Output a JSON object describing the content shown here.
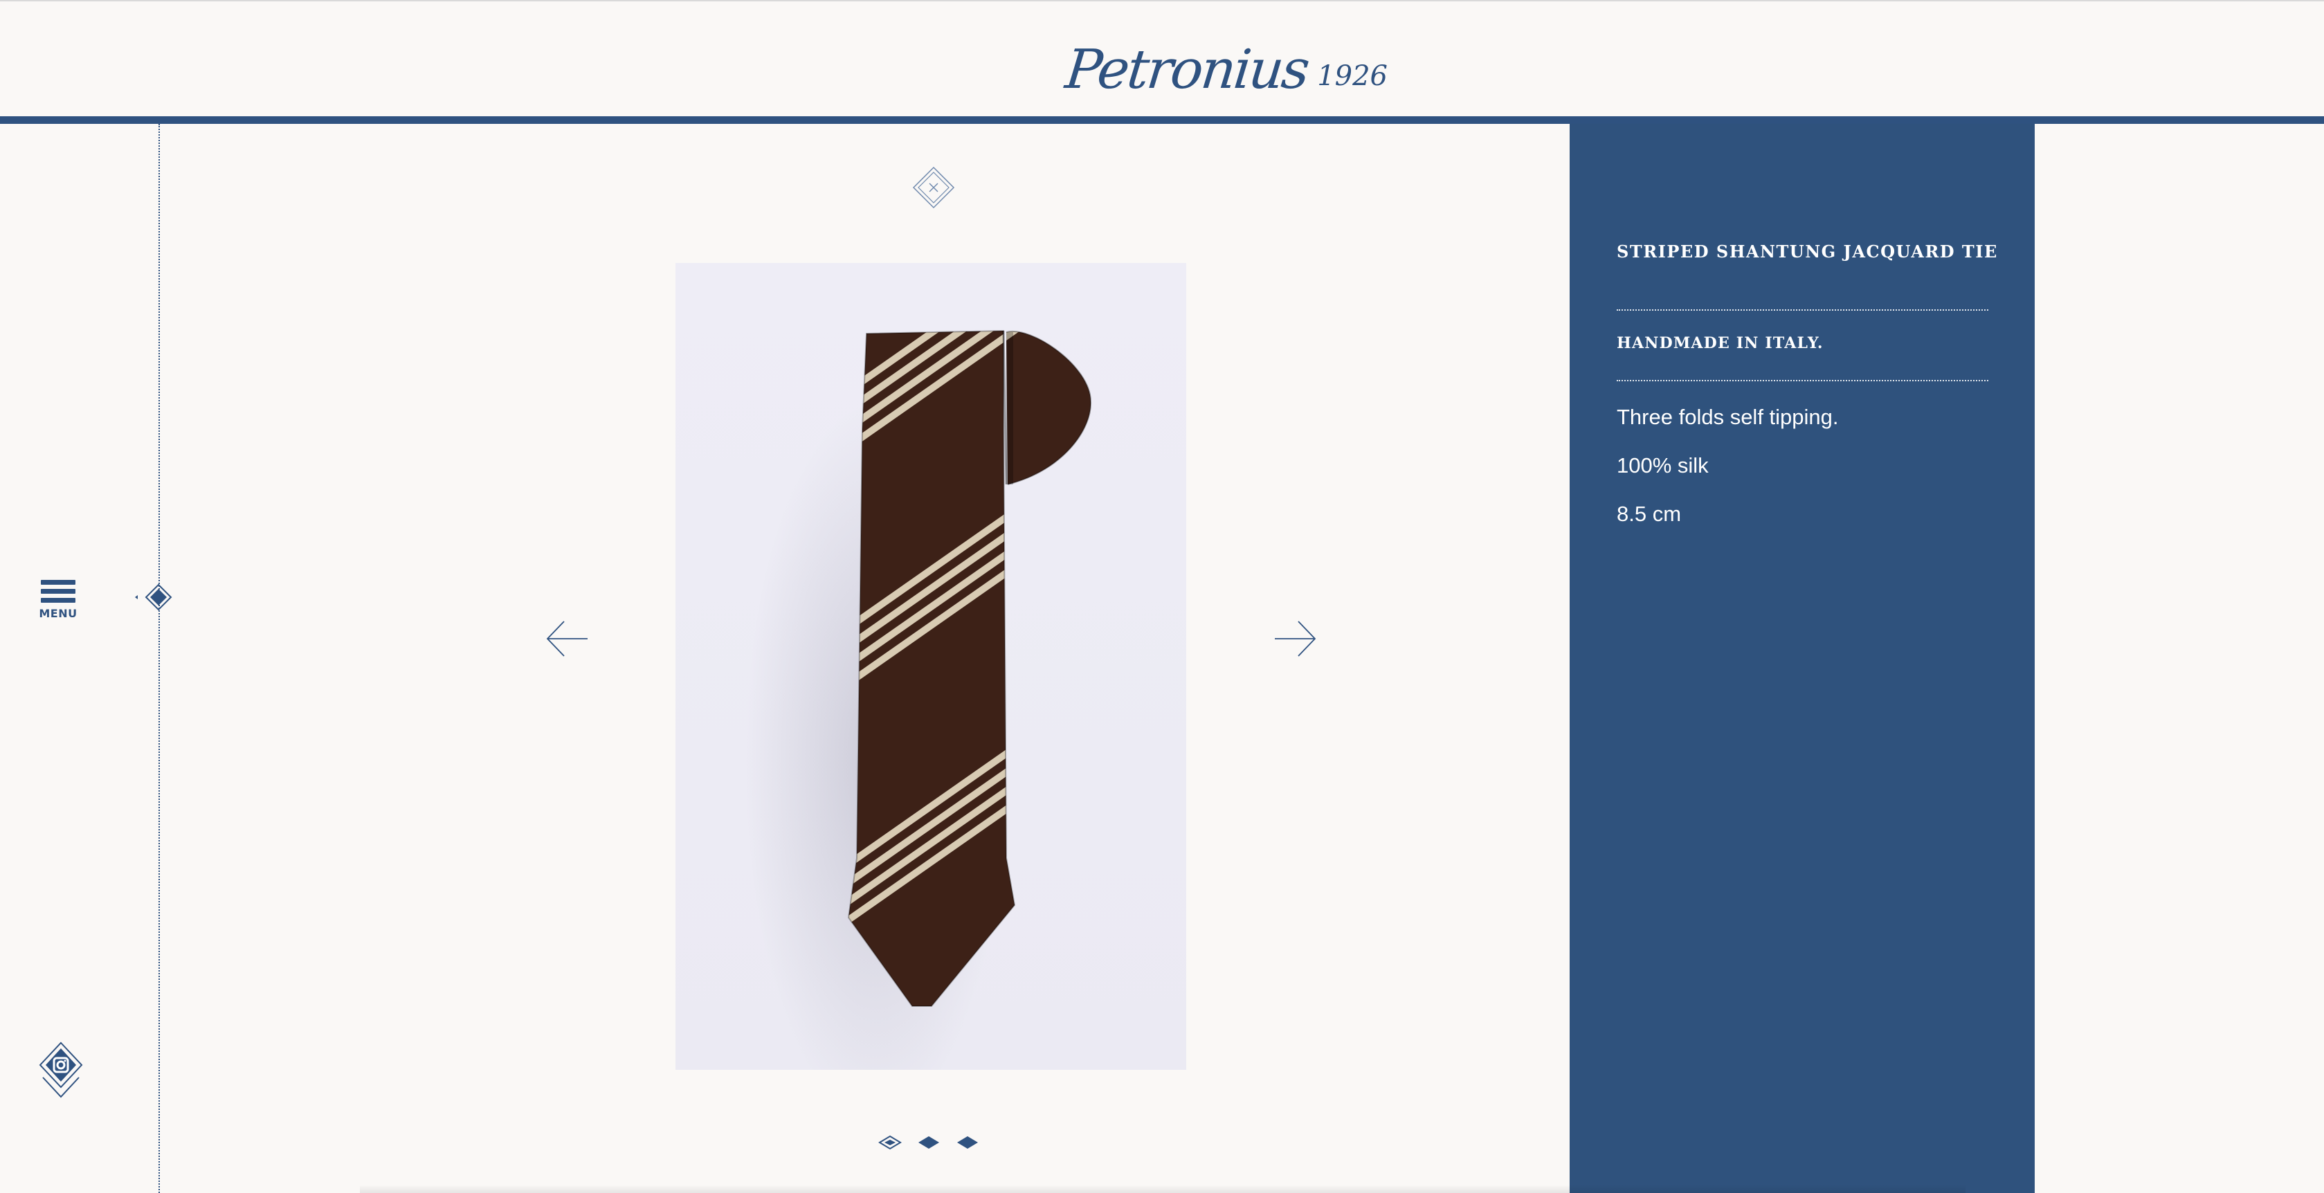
{
  "brand": {
    "logo_script": "Petronius",
    "logo_year": "1926"
  },
  "sidebar": {
    "menu_label": "MENU"
  },
  "product": {
    "title": "STRIPED SHANTUNG JACQUARD TIE",
    "subtitle": "HANDMADE IN ITALY.",
    "features": [
      "Three folds self tipping.",
      "100% silk",
      "8.5 cm"
    ]
  },
  "gallery": {
    "slide_count": 3,
    "active_slide": 1
  },
  "icons": {
    "menu": "hamburger-icon",
    "instagram": "instagram-icon",
    "close": "close-icon",
    "prev": "arrow-left-icon",
    "next": "arrow-right-icon"
  },
  "colors": {
    "brand_blue": "#2f5280",
    "background": "#faf8f6",
    "panel_text": "#ffffff",
    "tie_brown": "#3d2117",
    "tie_stripe": "#d8cbb3"
  }
}
